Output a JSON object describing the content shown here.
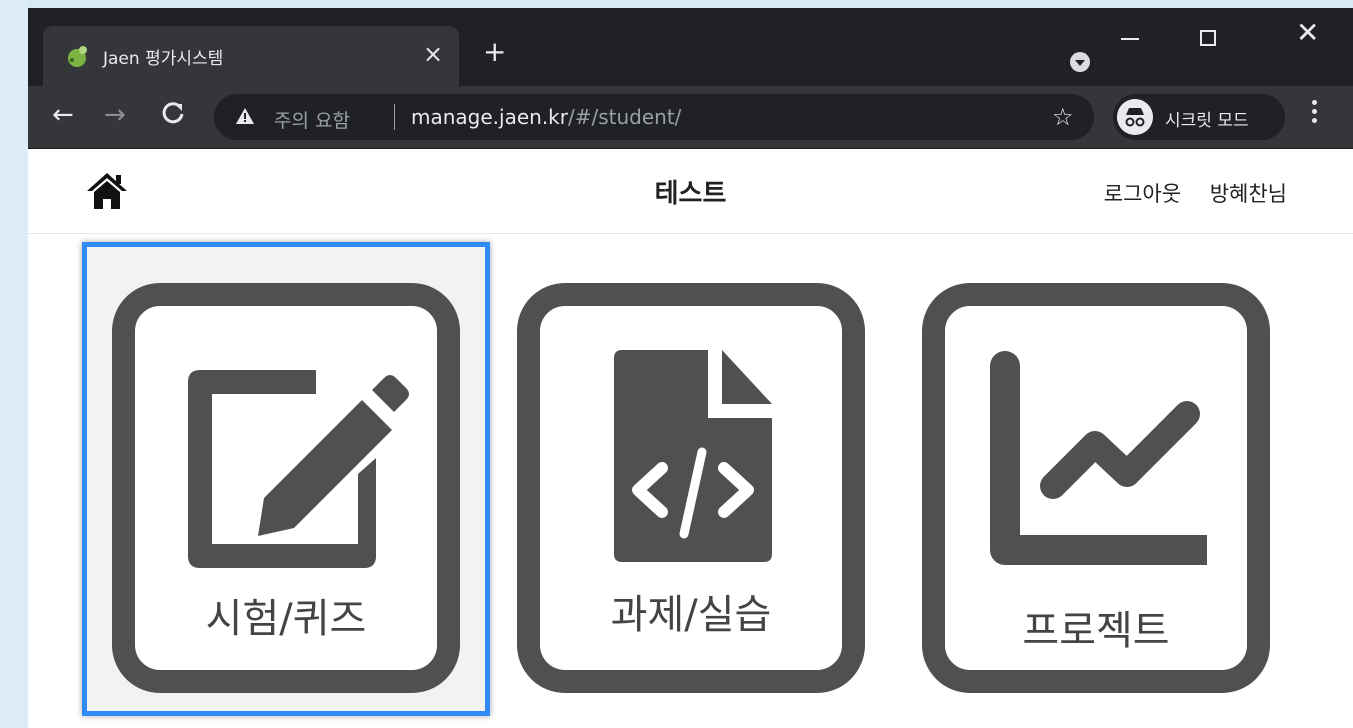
{
  "browser": {
    "tab_title": "Jaen 평가시스템",
    "tab_close": "×",
    "new_tab": "+",
    "security_label": "주의 요함",
    "url_host": "manage.jaen.kr",
    "url_path": "/#/student/",
    "incognito_label": "시크릿 모드"
  },
  "header": {
    "title": "테스트",
    "logout_label": "로그아웃",
    "user_label": "방혜찬님"
  },
  "cards": [
    {
      "label": "시험/퀴즈",
      "icon": "edit-icon",
      "selected": true
    },
    {
      "label": "과제/실습",
      "icon": "code-file-icon",
      "selected": false
    },
    {
      "label": "프로젝트",
      "icon": "line-chart-icon",
      "selected": false
    }
  ],
  "colors": {
    "selection": "#2f8bf5",
    "card_border": "#505050",
    "titlebar": "#202124",
    "toolbar": "#35363a"
  }
}
